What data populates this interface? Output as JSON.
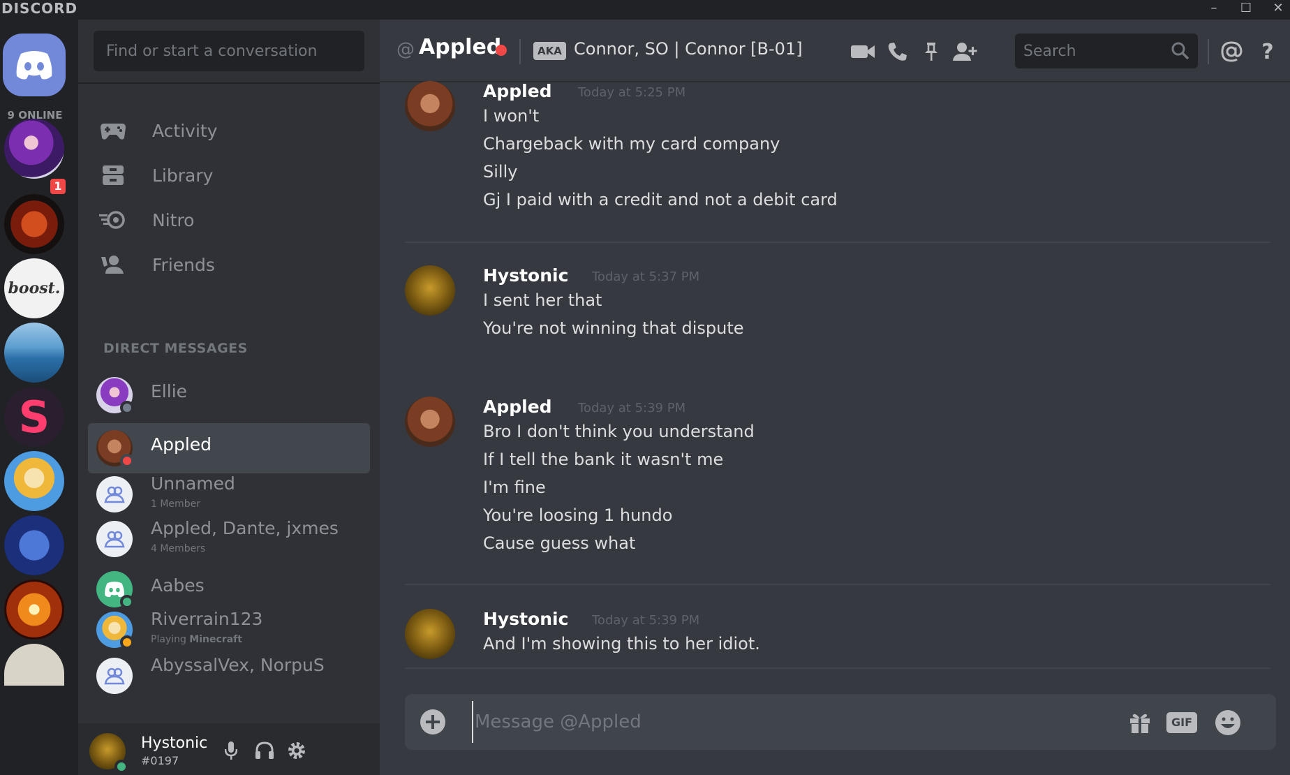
{
  "app": {
    "brand": "DISCORD",
    "window": {
      "minimize": "–",
      "maximize": "☐",
      "close": "✕"
    }
  },
  "guilds": {
    "online_label": "9 ONLINE",
    "unread_badge": "1",
    "items": [
      {
        "icon": "ellie-avatar"
      },
      {
        "icon": "server-icon-1"
      },
      {
        "icon": "server-boost",
        "text": "boost."
      },
      {
        "icon": "server-coast"
      },
      {
        "icon": "server-s",
        "text": "S"
      },
      {
        "icon": "server-anime"
      },
      {
        "icon": "server-blue"
      },
      {
        "icon": "server-orange"
      },
      {
        "icon": "server-partial"
      }
    ]
  },
  "sidebar": {
    "search_placeholder": "Find or start a conversation",
    "nav": [
      {
        "label": "Activity",
        "icon": "gamepad-icon"
      },
      {
        "label": "Library",
        "icon": "library-icon"
      },
      {
        "label": "Nitro",
        "icon": "nitro-icon"
      },
      {
        "label": "Friends",
        "icon": "friends-icon"
      }
    ],
    "dm_header": "DIRECT MESSAGES",
    "dms": [
      {
        "name": "Ellie",
        "sub": "",
        "status": "offline",
        "status_color": "#747f8d"
      },
      {
        "name": "Appled",
        "sub": "",
        "status": "dnd",
        "status_color": "#f04747",
        "active": true
      },
      {
        "name": "Unnamed",
        "sub": "1 Member",
        "group": true
      },
      {
        "name": "Appled, Dante, jxmes",
        "sub": "4 Members",
        "group": true
      },
      {
        "name": "Aabes",
        "sub": "",
        "status": "online",
        "status_color": "#43b581"
      },
      {
        "name": "Riverrain123",
        "sub_prefix": "Playing ",
        "sub_bold": "Minecraft",
        "status": "idle",
        "status_color": "#faa61a"
      },
      {
        "name": "AbyssalVex, NorpuS",
        "sub": "",
        "group": true
      }
    ]
  },
  "user_panel": {
    "name": "Hystonic",
    "tag": "#0197"
  },
  "chat": {
    "at_symbol": "@",
    "title": "Appled",
    "aka_label": "AKA",
    "aka_names": "Connor, SO | Connor [B-01]",
    "search_placeholder": "Search",
    "messages": [
      {
        "author": "Appled",
        "time": "Today at 5:25 PM",
        "lines": [
          "I won't",
          "Chargeback with my card company",
          "Silly",
          "Gj I paid with a credit and not a debit card"
        ]
      },
      {
        "author": "Hystonic",
        "time": "Today at 5:37 PM",
        "lines": [
          "I sent her that",
          "You're not winning that dispute"
        ]
      },
      {
        "author": "Appled",
        "time": "Today at 5:39 PM",
        "lines": [
          "Bro I don't think you understand",
          "If I tell the bank it wasn't me",
          "I'm fine",
          "You're loosing 1 hundo",
          "Cause guess what"
        ]
      },
      {
        "author": "Hystonic",
        "time": "Today at 5:39 PM",
        "lines": [
          "And I'm showing this to her idiot."
        ]
      }
    ],
    "composer_placeholder": "Message @Appled",
    "gif_label": "GIF"
  },
  "colors": {
    "blurple": "#7289da",
    "dnd": "#f04747",
    "online": "#43b581",
    "idle": "#faa61a"
  }
}
